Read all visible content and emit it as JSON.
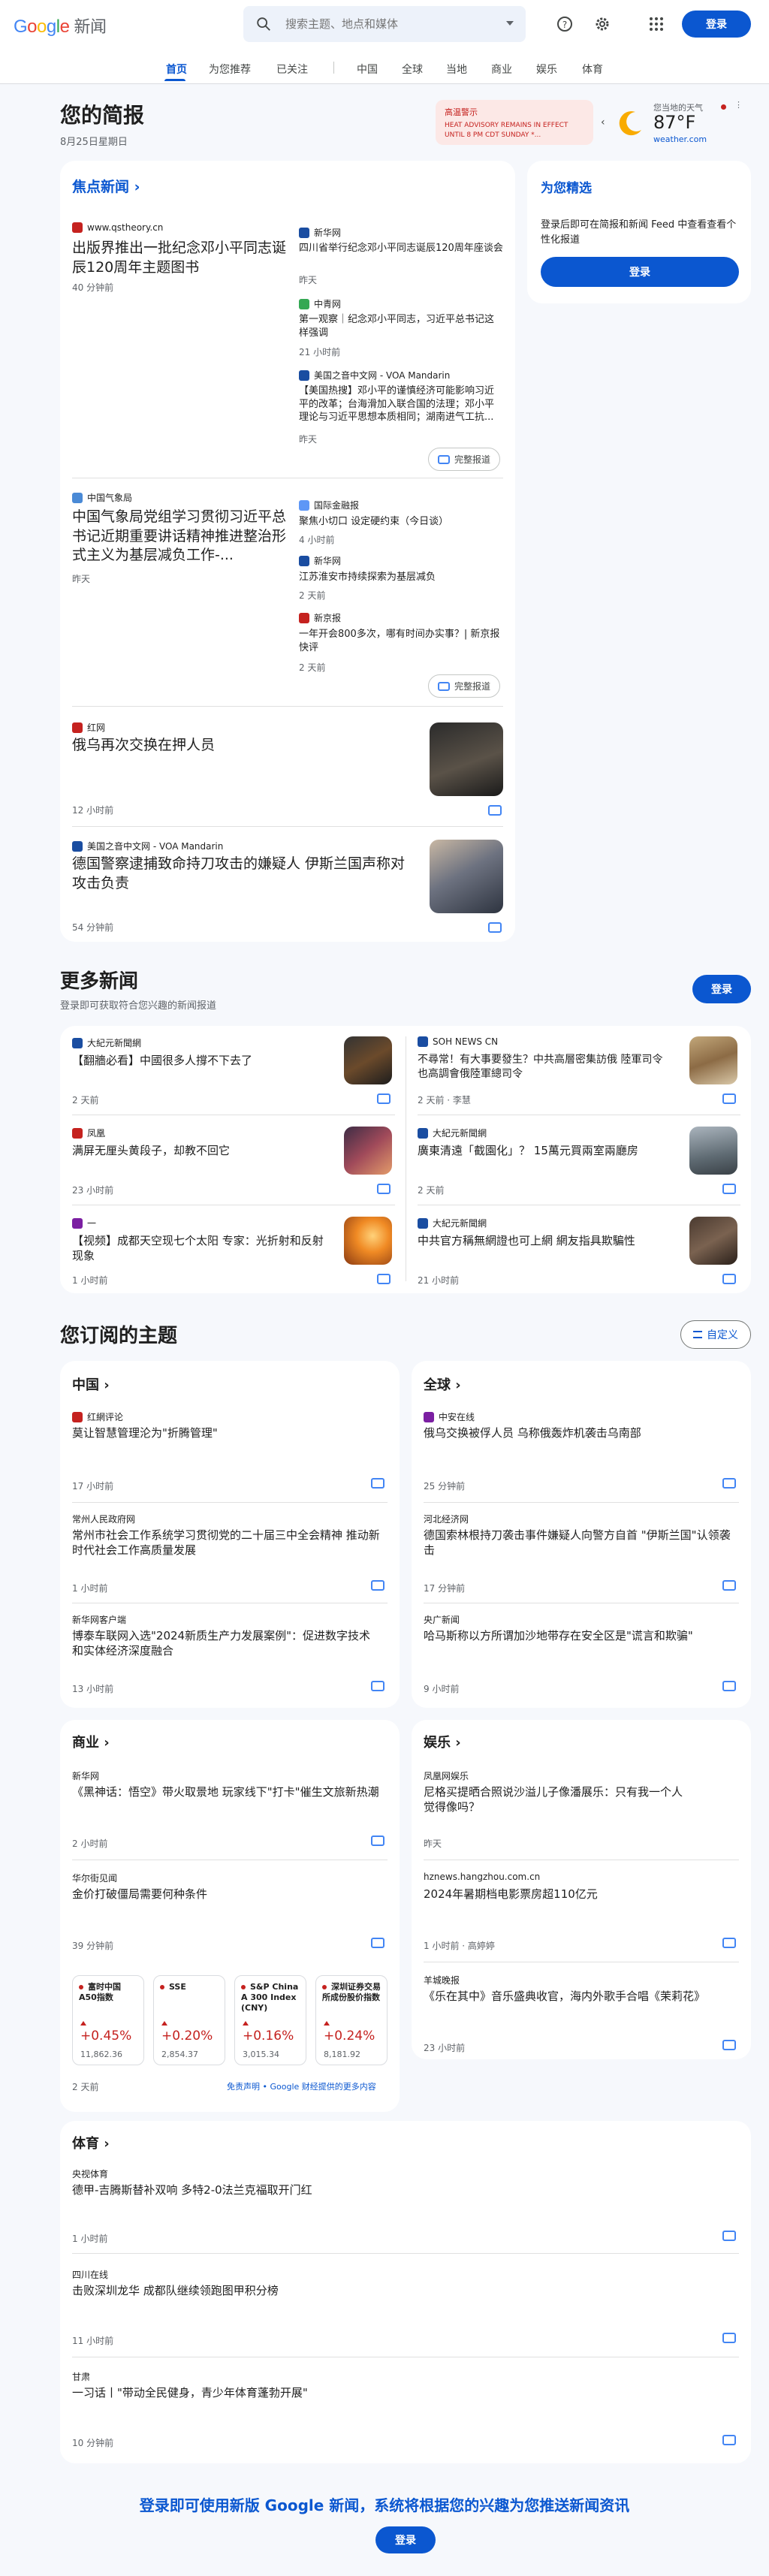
{
  "header": {
    "logo_google": "Google",
    "logo_news": "新闻",
    "search_placeholder": "搜索主题、地点和媒体",
    "signin": "登录",
    "icons": [
      "search-icon",
      "help-icon",
      "settings-icon",
      "apps-icon"
    ]
  },
  "nav": {
    "items": [
      "首页",
      "为您推荐",
      "已关注",
      "中国",
      "全球",
      "当地",
      "商业",
      "娱乐",
      "体育"
    ],
    "active": "首页"
  },
  "briefing": {
    "title": "您的简报",
    "date": "8月25日星期日",
    "alert_label": "高温警示",
    "alert_text": "HEAT ADVISORY REMAINS IN EFFECT UNTIL 8 PM CDT SUNDAY *...",
    "weather_label": "您当地的天气",
    "temp": "87°F",
    "weather_source": "weather.com"
  },
  "top_stories": {
    "title": "焦点新闻",
    "full_coverage": "完整报道",
    "clusters": [
      {
        "main": {
          "source": "www.qstheory.cn",
          "headline": "出版界推出一批纪念邓小平同志诞辰120周年主题图书",
          "time": "40 分钟前"
        },
        "side": [
          {
            "source": "新华网",
            "headline": "四川省举行纪念邓小平同志诞辰120周年座谈会",
            "time": "昨天"
          },
          {
            "source": "中青网",
            "headline": "第一观察｜纪念邓小平同志，习近平总书记这样强调",
            "time": "21 小时前"
          },
          {
            "source": "美国之音中文网 - VOA Mandarin",
            "headline": "【美国热搜】邓小平的谨慎经济可能影响习近平的改革；台海滑加入联合国的法理；邓小平理论与习近平思想本质相同；湖南进气工抗...",
            "time": "昨天"
          }
        ]
      },
      {
        "main": {
          "source": "中国气象局",
          "headline": "中国气象局党组学习贯彻习近平总书记近期重要讲话精神推进整治形式主义为基层减负工作-...",
          "time": "昨天"
        },
        "side": [
          {
            "source": "国际金融报",
            "headline": "聚焦小切口 设定硬约束（今日谈）",
            "time": "4 小时前"
          },
          {
            "source": "新华网",
            "headline": "江苏淮安市持续探索为基层减负",
            "time": "2 天前"
          },
          {
            "source": "新京报",
            "headline": "一年开会800多次，哪有时间办实事？| 新京报快评",
            "time": "2 天前"
          }
        ]
      }
    ],
    "singles": [
      {
        "source": "红网",
        "headline": "俄乌再次交换在押人员",
        "time": "12 小时前"
      },
      {
        "source": "美国之音中文网 - VOA Mandarin",
        "headline": "德国警察逮捕致命持刀攻击的嫌疑人 伊斯兰国声称对攻击负责",
        "time": "54 分钟前"
      }
    ]
  },
  "picks": {
    "title": "为您精选",
    "text": "登录后即可在简报和新闻 Feed 中查看查看个性化报道",
    "signin": "登录"
  },
  "more_news": {
    "title": "更多新闻",
    "subtitle": "登录即可获取符合您兴趣的新闻报道",
    "signin": "登录",
    "items": [
      {
        "source": "大紀元新聞網",
        "headline": "【翻牆必看】中國很多人撐不下去了",
        "time": "2 天前"
      },
      {
        "source": "SOH NEWS CN",
        "headline": "不尋常！有大事要發生？中共高層密集訪俄 陸軍司令也高調會俄陸軍總司令",
        "time": "2 天前 · 李慧"
      },
      {
        "source": "凤凰",
        "headline": "满屏无厘头黄段子，却教不回它",
        "time": "23 小时前"
      },
      {
        "source": "大紀元新聞網",
        "headline": "廣東清遠「截園化」？ 15萬元買兩室兩廳房",
        "time": "2 天前"
      },
      {
        "source": "一",
        "headline": "【视频】成都天空现七个太阳 专家：光折射和反射现象",
        "time": "1 小时前"
      },
      {
        "source": "大紀元新聞網",
        "headline": "中共官方稱無網證也可上網 網友指具欺騙性",
        "time": "21 小时前"
      }
    ]
  },
  "topics": {
    "title": "您订阅的主题",
    "customize": "自定义",
    "china": {
      "title": "中国",
      "items": [
        {
          "source": "红網评论",
          "headline": "莫让智慧管理沦为\"折腾管理\"",
          "time": "17 小时前"
        },
        {
          "source": "常州人民政府网",
          "headline": "常州市社会工作系统学习贯彻党的二十届三中全会精神 推动新时代社会工作高质量发展",
          "time": "1 小时前"
        },
        {
          "source": "新华网客户端",
          "headline": "博泰车联网入选\"2024新质生产力发展案例\"：促进数字技术和实体经济深度融合",
          "time": "13 小时前"
        }
      ]
    },
    "world": {
      "title": "全球",
      "items": [
        {
          "source": "中安在线",
          "headline": "俄乌交换被俘人员 乌称俄轰炸机袭击乌南部",
          "time": "25 分钟前"
        },
        {
          "source": "河北经济网",
          "headline": "德国索林根持刀袭击事件嫌疑人向警方自首 \"伊斯兰国\"认领袭击",
          "time": "17 分钟前"
        },
        {
          "source": "央广新闻",
          "headline": "哈马斯称以方所谓加沙地带存在安全区是\"谎言和欺骗\"",
          "time": "9 小时前"
        }
      ]
    },
    "business": {
      "title": "商业",
      "items": [
        {
          "source": "新华网",
          "headline": "《黑神话：悟空》带火取景地 玩家线下\"打卡\"催生文旅新热潮",
          "time": "2 小时前"
        },
        {
          "source": "华尔街见闻",
          "headline": "金价打破僵局需要何种条件",
          "time": "39 分钟前"
        }
      ],
      "stocks": [
        {
          "name": "富时中国A50指数",
          "pct": "+0.45%",
          "value": "11,862.36"
        },
        {
          "name": "SSE",
          "pct": "+0.20%",
          "value": "2,854.37"
        },
        {
          "name": "S&P China A 300 Index (CNY)",
          "pct": "+0.16%",
          "value": "3,015.34"
        },
        {
          "name": "深圳证券交易所成份股价指数",
          "pct": "+0.24%",
          "value": "8,181.92"
        }
      ],
      "stocks_time": "2 天前",
      "disclaimer": "免责声明 • Google 财经提供的更多内容"
    },
    "entertainment": {
      "title": "娱乐",
      "items": [
        {
          "source": "凤凰网娱乐",
          "headline": "尼格买提晒合照说沙溢儿子像潘展乐：只有我一个人觉得像吗？",
          "time": "昨天"
        },
        {
          "source": "hznews.hangzhou.com.cn",
          "headline": "2024年暑期档电影票房超110亿元",
          "time": "1 小时前 · 高婷婷"
        },
        {
          "source": "羊城晚报",
          "headline": "《乐在其中》音乐盛典收官，海内外歌手合唱《茉莉花》",
          "time": "23 小时前"
        }
      ]
    },
    "sports": {
      "title": "体育",
      "items": [
        {
          "source": "央视体育",
          "headline": "德甲-吉腾斯替补双响 多特2-0法兰克福取开门红",
          "time": "1 小时前"
        },
        {
          "source": "四川在线",
          "headline": "击败深圳龙华 成都队继续领跑图甲积分榜",
          "time": "11 小时前"
        },
        {
          "source": "甘肃",
          "headline": "一习话丨\"带动全民健身，青少年体育蓬勃开展\"",
          "time": "10 分钟前"
        }
      ]
    }
  },
  "footer": {
    "cta": "登录即可使用新版 Google 新闻，系统将根据您的兴趣为您推送新闻资讯",
    "signin": "登录"
  },
  "colors": {
    "accent": "#0b57d0",
    "alert": "#c5221f",
    "background": "#f6f8fc"
  }
}
